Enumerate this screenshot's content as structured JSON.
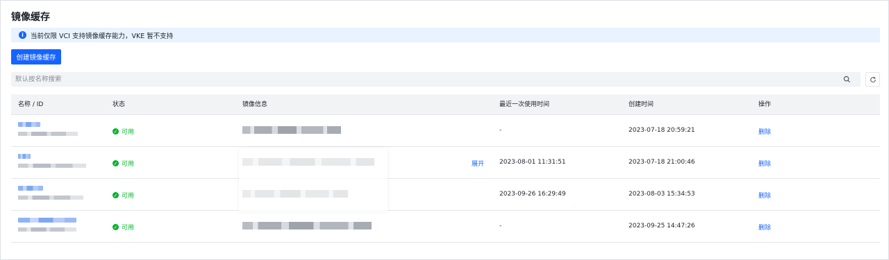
{
  "page": {
    "title": "镜像缓存"
  },
  "notice": {
    "text": "当前仅限 VCI 支持镜像缓存能力，VKE 暂不支持"
  },
  "toolbar": {
    "create_label": "创建镜像缓存"
  },
  "search": {
    "placeholder": "默认按名称搜索"
  },
  "table": {
    "headers": {
      "name": "名称 / ID",
      "status": "状态",
      "image": "镜像信息",
      "last_used": "最近一次使用时间",
      "created": "创建时间",
      "actions": "操作"
    },
    "rows": [
      {
        "status": "可用",
        "expand": "",
        "last_used": "-",
        "created": "2023-07-18 20:59:21",
        "action": "删除"
      },
      {
        "status": "可用",
        "expand": "展开",
        "last_used": "2023-08-01 11:31:51",
        "created": "2023-07-18 21:00:46",
        "action": "删除"
      },
      {
        "status": "可用",
        "expand": "",
        "last_used": "2023-09-26 16:29:49",
        "created": "2023-08-03 15:34:53",
        "action": "删除"
      },
      {
        "status": "可用",
        "expand": "",
        "last_used": "-",
        "created": "2023-09-25 14:47:26",
        "action": "删除"
      }
    ]
  },
  "colors": {
    "primary": "#1664ff",
    "success": "#00b42a",
    "notice_bg": "#e8f3ff"
  },
  "icons": {
    "notice": "info-icon",
    "search": "search-icon",
    "refresh": "refresh-icon",
    "status": "check-circle-icon"
  }
}
